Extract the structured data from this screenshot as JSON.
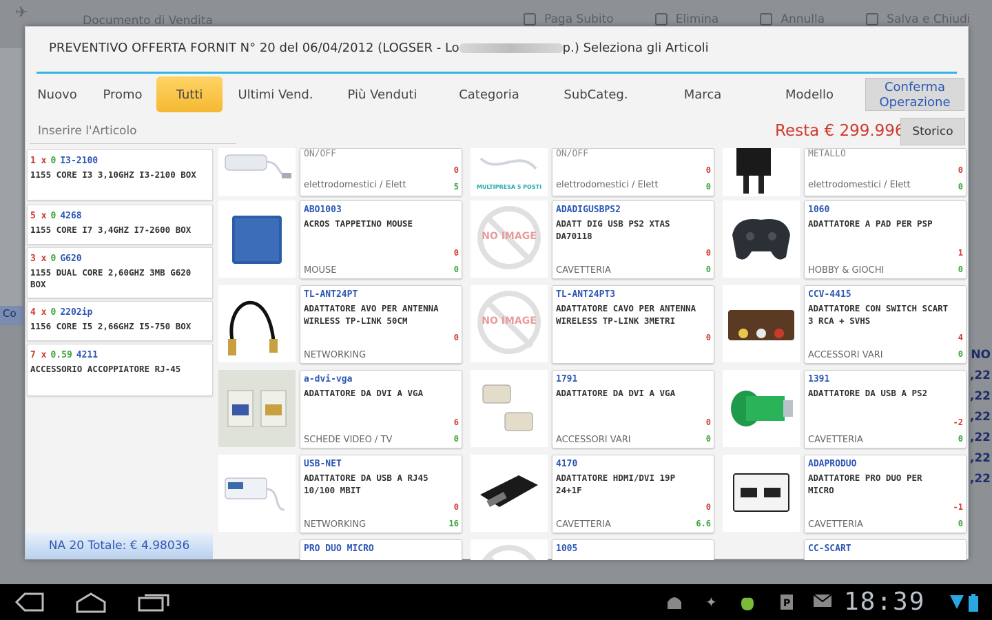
{
  "background": {
    "title": "Documento di Vendita",
    "actions": [
      "Paga Subito",
      "Elimina",
      "Annulla",
      "Salva e Chiudi"
    ],
    "right_values": [
      "NO",
      ",22",
      ",22",
      ",22",
      ",22",
      ",22",
      ",22"
    ],
    "left_strip": "Co"
  },
  "dialog": {
    "title_prefix": "PREVENTIVO OFFERTA FORNIT N° 20 del 06/04/2012 (LOGSER - Lo",
    "title_suffix": "p.) Seleziona gli Articoli"
  },
  "tabs": [
    {
      "label": "Nuovo",
      "active": false
    },
    {
      "label": "Promo",
      "active": false
    },
    {
      "label": "Tutti",
      "active": true
    },
    {
      "label": "Ultimi Vend.",
      "active": false
    },
    {
      "label": "Più Venduti",
      "active": false
    },
    {
      "label": "Categoria",
      "active": false
    },
    {
      "label": "SubCateg.",
      "active": false
    },
    {
      "label": "Marca",
      "active": false
    },
    {
      "label": "Modello",
      "active": false
    }
  ],
  "confirm_button": {
    "line1": "Conferma",
    "line2": "Operazione"
  },
  "search": {
    "placeholder": "Inserire l'Articolo"
  },
  "resta": "Resta € 299.996",
  "storico": "Storico",
  "cart": {
    "items": [
      {
        "qty": "1 x",
        "price": "0",
        "code": "I3-2100",
        "desc": "1155 CORE I3 3,10GHZ I3-2100 BOX"
      },
      {
        "qty": "5 x",
        "price": "0",
        "code": "4268",
        "desc": "1155 CORE I7 3,4GHZ I7-2600 BOX"
      },
      {
        "qty": "3 x",
        "price": "0",
        "code": "G620",
        "desc": "1155 DUAL CORE 2,60GHZ 3MB G620 BOX"
      },
      {
        "qty": "4 x",
        "price": "0",
        "code": "2202ip",
        "desc": "1156 CORE I5 2,66GHZ I5-750 BOX"
      },
      {
        "qty": "7 x",
        "price": "0.59",
        "code": "4211",
        "desc": "ACCESSORIO ACCOPPIATORE RJ-45"
      }
    ],
    "total": "NA 20 Totale: € 4.98036"
  },
  "partial_row": [
    {
      "top_text": "ON/OFF",
      "cat": "elettrodomestici / Elett",
      "n1": "0",
      "n2": "5",
      "img": "usb-hub"
    },
    {
      "top_text": "ON/OFF",
      "cat": "elettrodomestici / Elett",
      "n1": "0",
      "n2": "0",
      "img": "cable",
      "img_label": "MULTIPRESA 5 POSTI"
    },
    {
      "top_text": "METALLO",
      "cat": "elettrodomestici / Elett",
      "n1": "0",
      "n2": "0",
      "img": "stand"
    }
  ],
  "products": [
    {
      "code": "ABO1003",
      "desc": "ACROS TAPPETINO MOUSE",
      "cat": "MOUSE",
      "n1": "0",
      "n2": "0",
      "img": "mousepad"
    },
    {
      "code": "ADADIGUSBPS2",
      "desc": "ADATT DIG USB PS2 XTAS DA70118",
      "cat": "CAVETTERIA",
      "n1": "0",
      "n2": "0",
      "img": "noimage"
    },
    {
      "code": "1060",
      "desc": "ADATTATORE A PAD PER PSP",
      "cat": "HOBBY & GIOCHI",
      "n1": "1",
      "n2": "0",
      "img": "gamepad"
    },
    {
      "code": "TL-ANT24PT",
      "desc": "ADATTATORE AVO PER ANTENNA WIRLESS TP-LINK 50CM",
      "cat": "NETWORKING",
      "n1": "0",
      "n2": "",
      "img": "cable-black"
    },
    {
      "code": "TL-ANT24PT3",
      "desc": "ADATTATORE CAVO PER ANTENNA WIRELESS TP-LINK 3METRI",
      "cat": "",
      "n1": "0",
      "n2": "",
      "img": "noimage"
    },
    {
      "code": "CCV-4415",
      "desc": "ADATTATORE CON SWITCH SCART 3 RCA + SVHS",
      "cat": "ACCESSORI VARI",
      "n1": "4",
      "n2": "0",
      "img": "scart"
    },
    {
      "code": "a-dvi-vga",
      "desc": "ADATTATORE DA DVI A VGA",
      "cat": "SCHEDE VIDEO / TV",
      "n1": "6",
      "n2": "0",
      "img": "dvi-white"
    },
    {
      "code": "1791",
      "desc": "ADATTATORE DA DVI A VGA",
      "cat": "ACCESSORI VARI",
      "n1": "0",
      "n2": "0",
      "img": "dvi-beige"
    },
    {
      "code": "1391",
      "desc": "ADATTATORE DA USB A PS2",
      "cat": "CAVETTERIA",
      "n1": "-2",
      "n2": "0",
      "img": "ps2"
    },
    {
      "code": "USB-NET",
      "desc": "ADATTATORE DA USB A RJ45 10/100 MBIT",
      "cat": "NETWORKING",
      "n1": "0",
      "n2": "16",
      "img": "usbnet"
    },
    {
      "code": "4170",
      "desc": "ADATTATORE HDMI/DVI 19P 24+1F",
      "cat": "CAVETTERIA",
      "n1": "0",
      "n2": "6.6",
      "img": "hdmi"
    },
    {
      "code": "ADAPRODUO",
      "desc": "ADATTATORE PRO DUO PER MICRO",
      "cat": "CAVETTERIA",
      "n1": "-1",
      "n2": "0",
      "img": "produo"
    }
  ],
  "bottom_partial": [
    "PRO DUO MICRO",
    "1005",
    "CC-SCART"
  ],
  "no_image_label": "NO IMAGE",
  "statusbar": {
    "clock": "18:39"
  }
}
